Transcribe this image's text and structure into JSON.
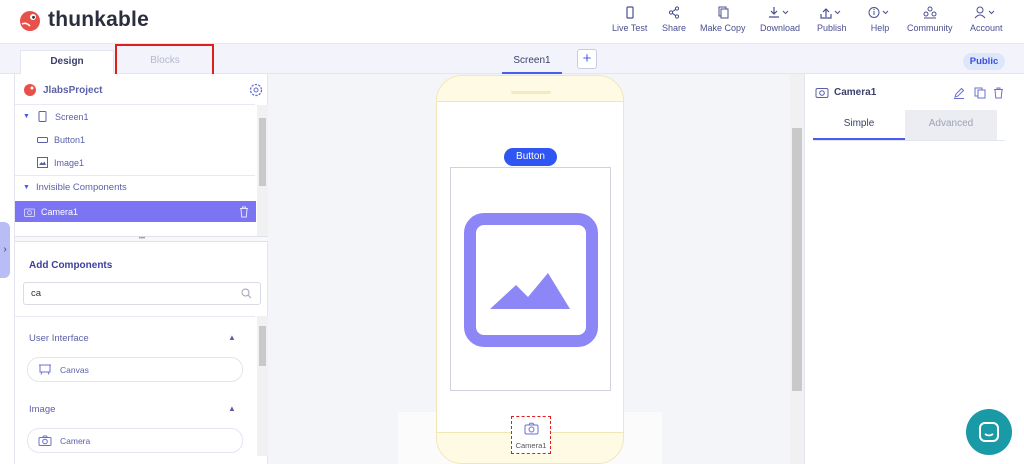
{
  "app": {
    "brand": "thunkable"
  },
  "toolbar": {
    "items": [
      {
        "label": "Live Test",
        "icon": "phone-icon"
      },
      {
        "label": "Share",
        "icon": "share-icon"
      },
      {
        "label": "Make Copy",
        "icon": "copy-icon"
      },
      {
        "label": "Download",
        "icon": "download-icon"
      },
      {
        "label": "Publish",
        "icon": "publish-icon"
      },
      {
        "label": "Help",
        "icon": "help-icon"
      },
      {
        "label": "Community",
        "icon": "community-icon"
      },
      {
        "label": "Account",
        "icon": "account-icon"
      }
    ]
  },
  "tabs": {
    "design": "Design",
    "blocks": "Blocks",
    "screen": "Screen1",
    "add": "+",
    "visibility": "Public"
  },
  "project": {
    "name": "JlabsProject"
  },
  "tree": {
    "screen": "Screen1",
    "button": "Button1",
    "image": "Image1",
    "invisible_header": "Invisible Components",
    "camera": "Camera1"
  },
  "components": {
    "title": "Add Components",
    "search_value": "ca",
    "ui_header": "User Interface",
    "canvas": "Canvas",
    "image_header": "Image",
    "camera": "Camera"
  },
  "preview": {
    "button_label": "Button",
    "camera_label": "Camera1"
  },
  "properties": {
    "title": "Camera1",
    "tab_simple": "Simple",
    "tab_advanced": "Advanced"
  },
  "colors": {
    "accent": "#4a5cf0",
    "purple": "#8c86f7",
    "selected": "#7b74f3",
    "highlight": "#e01e1e"
  }
}
